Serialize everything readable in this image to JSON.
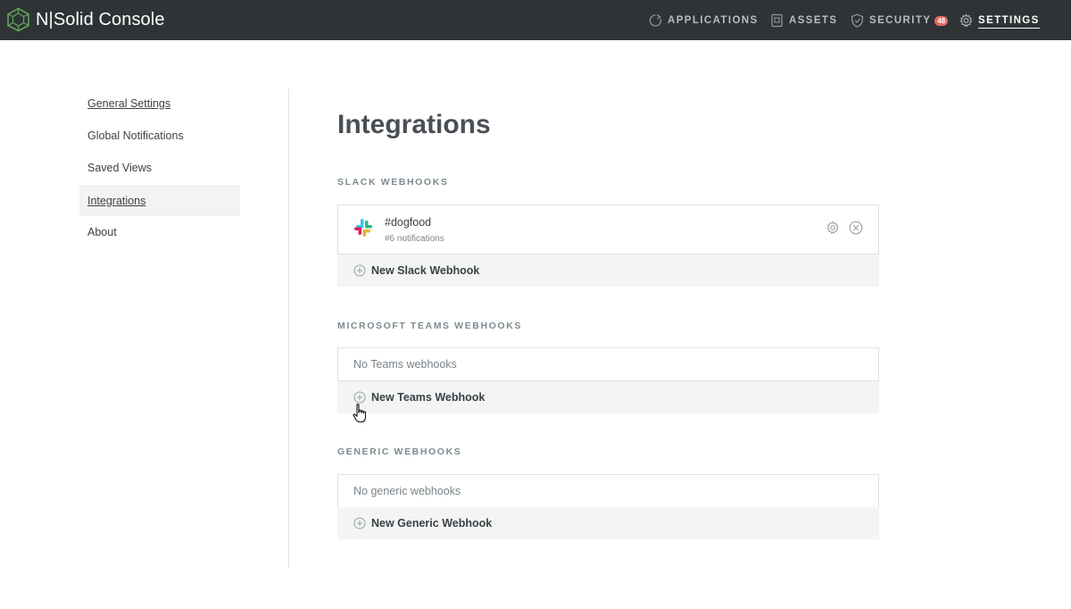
{
  "app": {
    "title": "N|Solid Console"
  },
  "nav": {
    "applications": "APPLICATIONS",
    "assets": "ASSETS",
    "security": "SECURITY",
    "security_badge": "48",
    "settings": "SETTINGS"
  },
  "sidebar": {
    "items": [
      {
        "label": "General Settings"
      },
      {
        "label": "Global Notifications"
      },
      {
        "label": "Saved Views"
      },
      {
        "label": "Integrations"
      },
      {
        "label": "About"
      }
    ]
  },
  "main": {
    "title": "Integrations",
    "slack": {
      "heading": "SLACK WEBHOOKS",
      "webhook_name": "#dogfood",
      "webhook_sub": "#6 notifications",
      "add_label": "New Slack Webhook"
    },
    "teams": {
      "heading": "MICROSOFT TEAMS WEBHOOKS",
      "empty": "No Teams webhooks",
      "add_label": "New Teams Webhook"
    },
    "generic": {
      "heading": "GENERIC WEBHOOKS",
      "empty": "No generic webhooks",
      "add_label": "New Generic Webhook"
    }
  },
  "colors": {
    "topbar": "#2f3335",
    "accent_green": "#5fa55a",
    "badge": "#e46c5f",
    "selected_bg": "#f2f3f3"
  },
  "icons": {
    "brand": "cube-logo-icon",
    "applications": "applications-icon",
    "assets": "assets-icon",
    "security": "shield-icon",
    "settings": "gear-icon",
    "slack": "slack-logo-icon",
    "webhook_settings": "gear-icon",
    "webhook_remove": "close-circle-icon",
    "add": "plus-circle-icon",
    "cursor": "hand-pointer-icon"
  }
}
